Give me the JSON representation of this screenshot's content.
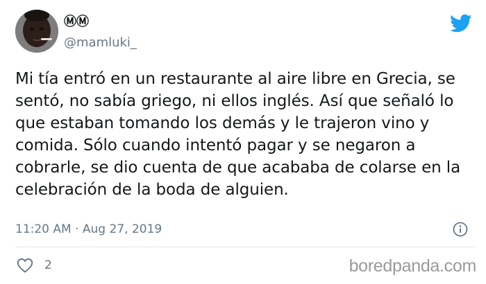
{
  "author": {
    "display_name": "ⓂⓂ",
    "handle": "@mamluki_"
  },
  "tweet": {
    "text": "Mi tía entró en un restaurante al aire libre en Grecia, se sentó, no sabía griego, ni ellos inglés. Así que señaló lo que estaban tomando los demás y le trajeron vino y comida. Sólo cuando intentó pagar y se negaron a cobrarle, se dio cuenta de que acababa de colarse en la celebración de la boda de alguien.",
    "timestamp": "11:20 AM · Aug 27, 2019"
  },
  "engagement": {
    "like_count": "2"
  },
  "watermark": {
    "text": "boredpanda.com"
  },
  "colors": {
    "twitter_blue": "#1da1f2",
    "secondary_text": "#657786"
  },
  "icons": [
    "twitter-bird-icon",
    "info-icon",
    "heart-icon"
  ]
}
